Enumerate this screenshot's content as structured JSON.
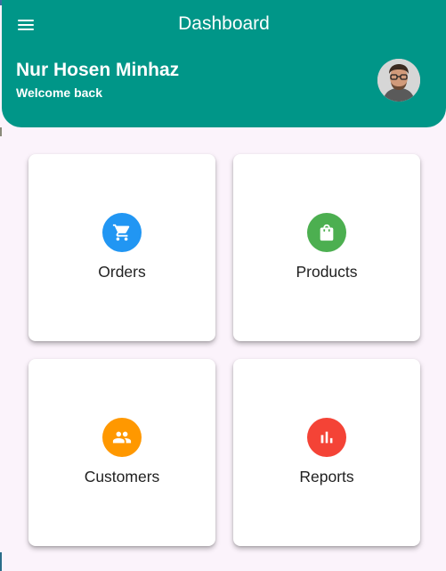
{
  "app_bar": {
    "title": "Dashboard",
    "menu_icon": "menu-icon"
  },
  "header": {
    "user_name": "Nur Hosen Minhaz",
    "greeting": "Welcome back"
  },
  "colors": {
    "header": "#009688",
    "background": "#fbf3fb",
    "orders": "#2196f3",
    "products": "#4caf50",
    "customers": "#ff9800",
    "reports": "#f44336"
  },
  "cards": [
    {
      "label": "Orders",
      "icon": "shopping-cart-icon"
    },
    {
      "label": "Products",
      "icon": "shopping-bag-icon"
    },
    {
      "label": "Customers",
      "icon": "people-icon"
    },
    {
      "label": "Reports",
      "icon": "bar-chart-icon"
    }
  ]
}
